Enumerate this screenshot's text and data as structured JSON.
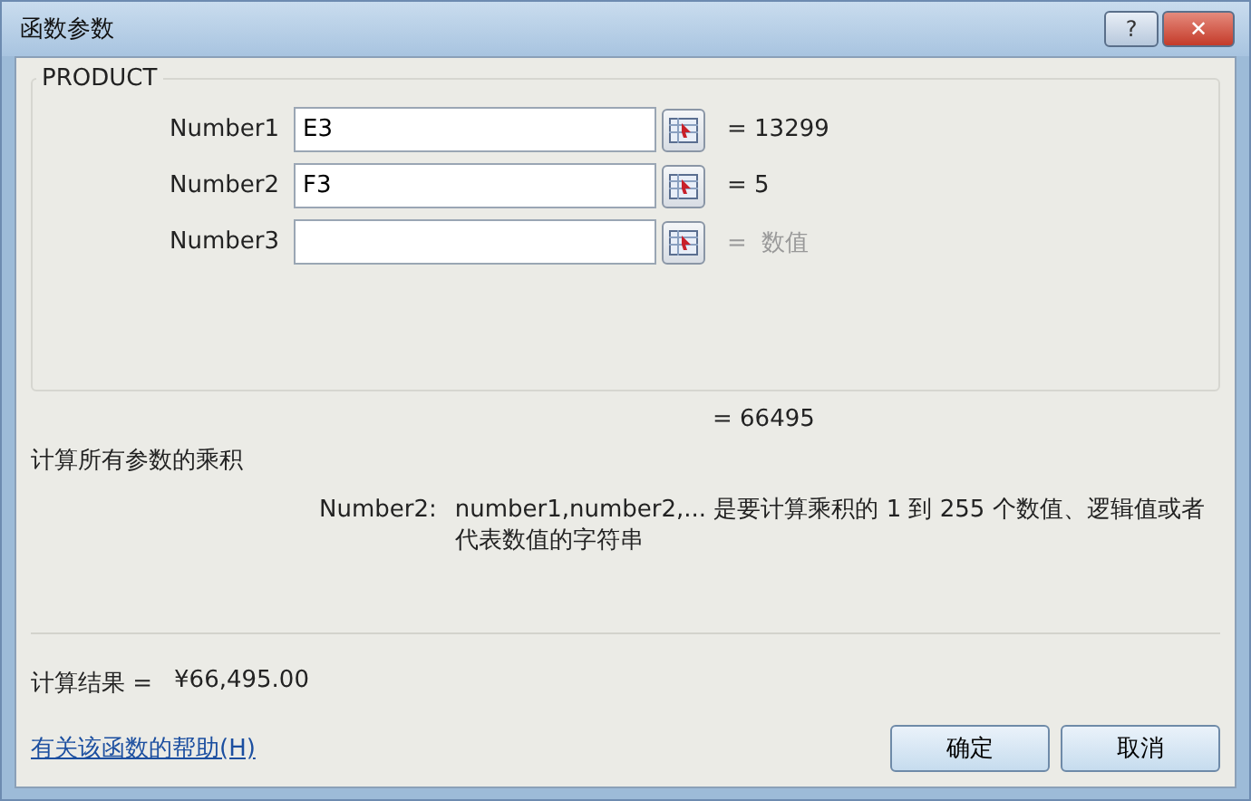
{
  "window": {
    "title": "函数参数",
    "help_button": "?",
    "close_button": "✕"
  },
  "function": {
    "name": "PRODUCT",
    "args": [
      {
        "label": "Number1",
        "value": "E3",
        "result": "= 13299",
        "placeholder_result": false
      },
      {
        "label": "Number2",
        "value": "F3",
        "result": "= 5",
        "placeholder_result": false
      },
      {
        "label": "Number3",
        "result": "=  数值",
        "placeholder_result": true
      }
    ]
  },
  "formula_result": "= 66495",
  "description": "计算所有参数的乘积",
  "arg_help": {
    "label": "Number2:",
    "text": "number1,number2,... 是要计算乘积的 1 到 255 个数值、逻辑值或者代表数值的字符串"
  },
  "calc_result": {
    "label": "计算结果 =",
    "value": "¥66,495.00"
  },
  "help_link": "有关该函数的帮助(H)",
  "buttons": [
    "确定",
    "取消"
  ]
}
